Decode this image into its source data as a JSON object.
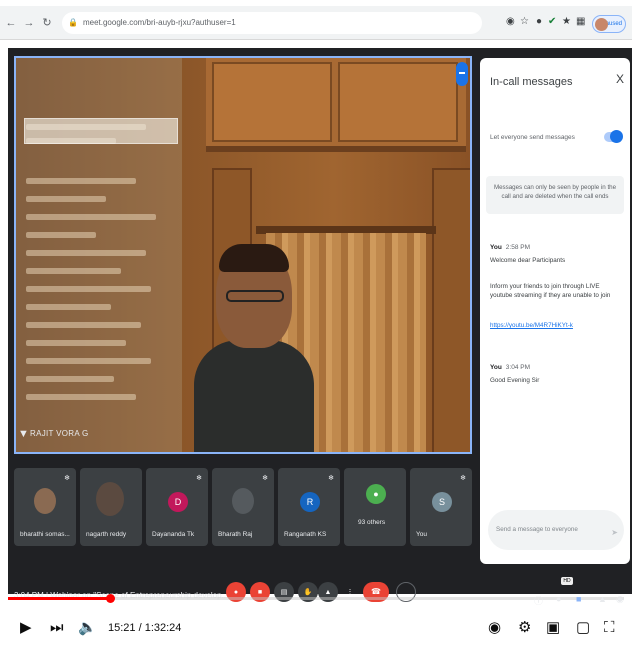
{
  "browser": {
    "url": "meet.google.com/bri-auyb-rjxu?authuser=1",
    "profile_label": "Paused",
    "back_icon": "back-arrow-icon",
    "forward_icon": "forward-arrow-icon",
    "reload_icon": "reload-icon",
    "lock_icon": "lock-icon"
  },
  "stage": {
    "presenter_name": "RAJIT VORA G"
  },
  "panel": {
    "title": "In-call messages",
    "close_label": "X",
    "toggle_label": "Let everyone send messages",
    "notice": "Messages can only be seen by people in the call and are deleted when the call ends",
    "messages": [
      {
        "sender": "You",
        "time": "2:58 PM",
        "lines": [
          "Welcome dear Participants",
          "Inform your friends to join through LIVE youtube streaming if they are unable to join"
        ],
        "link": "https://youtu.be/M4R7HiKYt-k"
      },
      {
        "sender": "You",
        "time": "3:04 PM",
        "lines": [
          "Good Evening Sir"
        ]
      }
    ],
    "input_placeholder": "Send a message to everyone"
  },
  "tiles": [
    {
      "name": "bharathi somas...",
      "kind": "photo",
      "color": "#8a6a52"
    },
    {
      "name": "nagarth reddy",
      "kind": "photo",
      "color": "#5b4a40"
    },
    {
      "name": "Dayananda Tk",
      "kind": "letter",
      "letter": "D",
      "color": "#c2185b"
    },
    {
      "name": "Bharath Raj",
      "kind": "photo",
      "color": "#555a5e"
    },
    {
      "name": "Ranganath KS",
      "kind": "letter",
      "letter": "R",
      "color": "#1565c0"
    },
    {
      "name": "93 others",
      "kind": "group",
      "color": "#4caf50"
    },
    {
      "name": "You",
      "kind": "letter",
      "letter": "S",
      "color": "#78909c"
    }
  ],
  "video": {
    "title": "3:04 PM | Webinar on \"Scope of Entrepreneurship develop...",
    "current_time": "15:21 / 1:32:24",
    "progress": 0.166,
    "hd_label": "HD"
  },
  "colors": {
    "accent": "#1a73e8",
    "end_call": "#ea4335",
    "progress": "#ff0000"
  }
}
